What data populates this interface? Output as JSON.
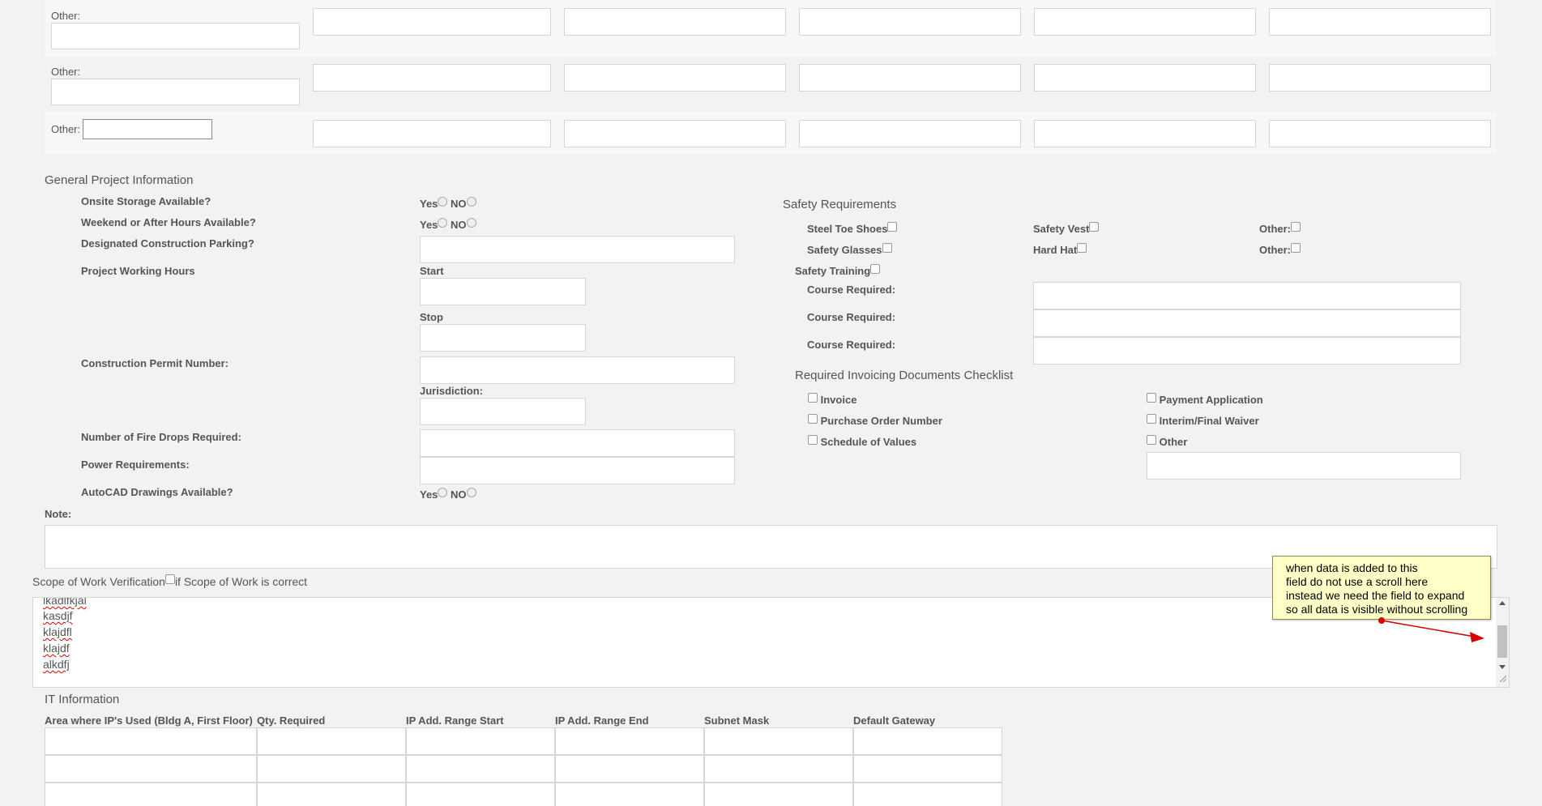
{
  "other_rows": {
    "label": "Other:",
    "rows": [
      {
        "row": 1
      },
      {
        "row": 2
      },
      {
        "row": 3
      }
    ]
  },
  "general": {
    "title": "General Project Information",
    "onsite_storage": "Onsite Storage Available?",
    "weekend_hours": "Weekend or After Hours Available?",
    "parking": "Designated Construction Parking?",
    "working_hours": "Project Working Hours",
    "start": "Start",
    "stop": "Stop",
    "permit": "Construction Permit Number:",
    "jurisdiction": "Jurisdiction:",
    "fire_drops": "Number of Fire Drops Required:",
    "power": "Power Requirements:",
    "autocad": "AutoCAD Drawings Available?",
    "yes": "Yes",
    "no": "NO",
    "note": "Note:"
  },
  "safety": {
    "title": "Safety Requirements",
    "steel_toe": "Steel Toe Shoes",
    "safety_vest": "Safety Vest",
    "other1": "Other:",
    "safety_glasses": "Safety Glasses",
    "hard_hat": "Hard Hat",
    "other2": "Other:",
    "training": "Safety Training",
    "course1": "Course Required:",
    "course2": "Course Required:",
    "course3": "Course Required:"
  },
  "invoicing": {
    "title": "Required Invoicing Documents Checklist",
    "invoice": "Invoice",
    "payment_app": "Payment Application",
    "po_number": "Purchase Order Number",
    "waiver": "Interim/Final Waiver",
    "sov": "Schedule of Values",
    "other": "Other"
  },
  "scope": {
    "title": "Scope of Work Verification",
    "check_label": "if Scope of Work is correct",
    "lines": [
      "lkadlfkjal",
      "kasdjf",
      "klajdfl",
      "klajdf",
      "alkdfj"
    ]
  },
  "callout": {
    "lines": [
      "when data is added to this",
      "field do not use a scroll here",
      "instead we need the field to expand",
      "so all data is visible without scrolling"
    ],
    "color": "#d40000"
  },
  "it": {
    "title": "IT Information",
    "columns": [
      "Area where IP's Used (Bldg A, First Floor)",
      "Qty. Required",
      "IP Add. Range Start",
      "IP Add. Range End",
      "Subnet Mask",
      "Default Gateway"
    ]
  }
}
